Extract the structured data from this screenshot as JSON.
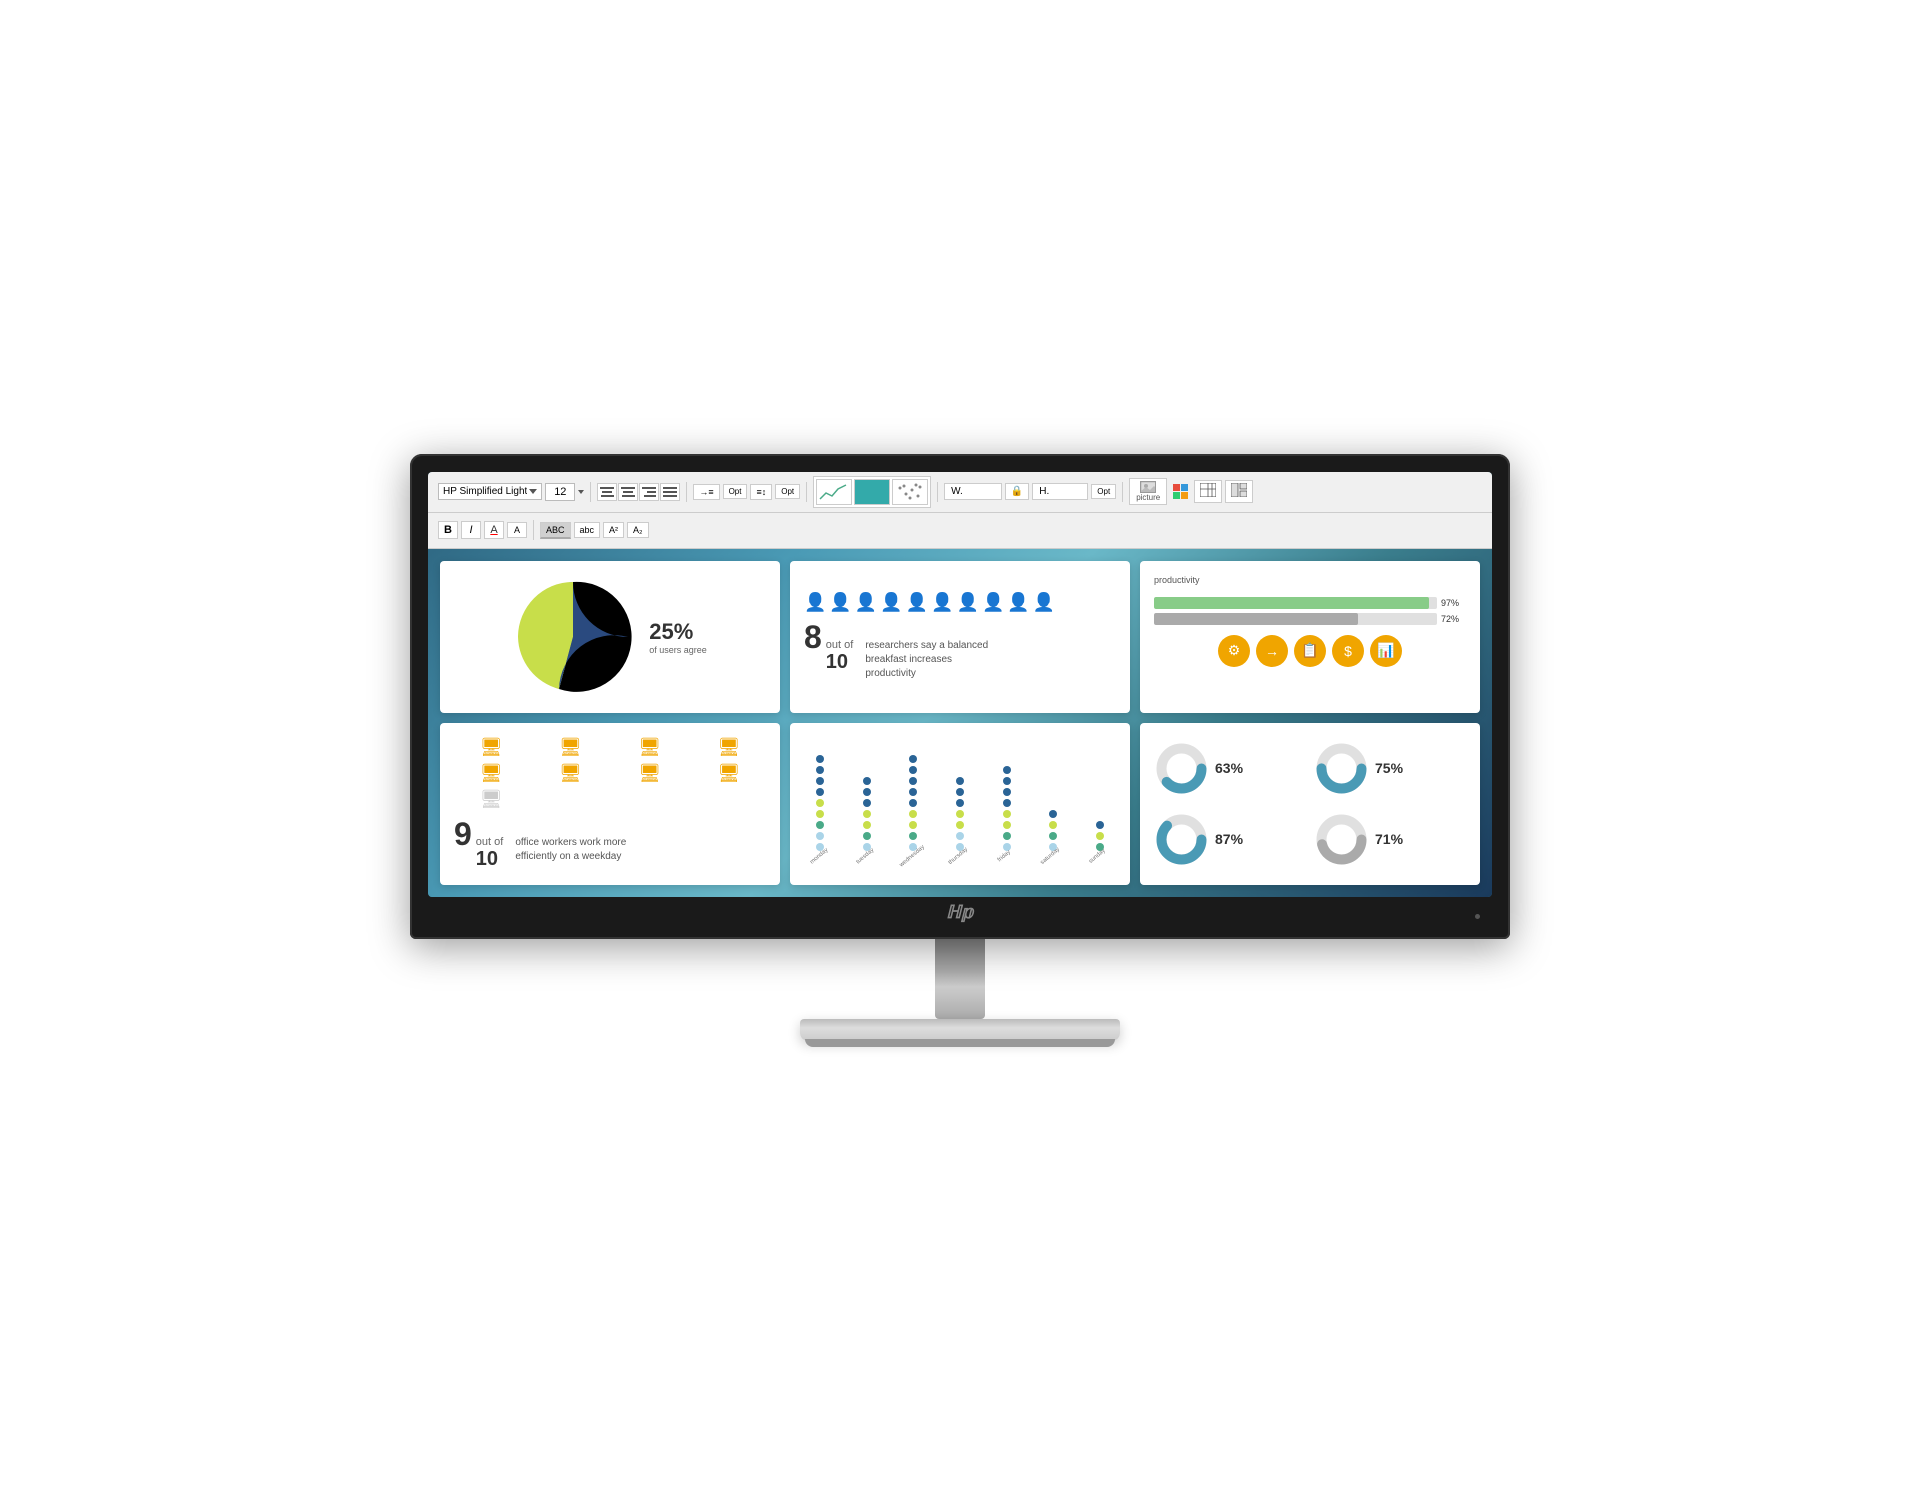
{
  "monitor": {
    "brand": "hp",
    "logo_symbol": "ℍ𝕡"
  },
  "toolbar": {
    "font_family": "HP Simplified Light",
    "font_size": "12",
    "bold": "B",
    "italic": "I",
    "font_a_upper": "A",
    "font_a_lower": "A",
    "abc_upper": "ABC",
    "abc_lower": "abc",
    "superscript": "A²",
    "subscript": "A₂",
    "picture_label": "picture",
    "width_label": "W.",
    "height_label": "H.",
    "opt_label": "Opt"
  },
  "slide": {
    "card_pie": {
      "percent": "25%",
      "sublabel": "of users agree"
    },
    "card_researchers": {
      "big_num": "8",
      "out_of": "out of",
      "of_num": "10",
      "description": "researchers say a balanced breakfast increases productivity",
      "filled_icons": 8,
      "total_icons": 10
    },
    "card_productivity": {
      "title": "productivity",
      "bar1_label": "",
      "bar1_pct": "97%",
      "bar1_value": 97,
      "bar1_color": "#88cc88",
      "bar2_label": "",
      "bar2_pct": "72%",
      "bar2_value": 72,
      "bar2_color": "#aaaaaa"
    },
    "card_computers": {
      "big_num": "9",
      "out_of": "out of",
      "of_num": "10",
      "description": "office workers work more efficiently on a weekday",
      "filled_count": 9,
      "total_count": 10
    },
    "card_dotchart": {
      "days": [
        "monday",
        "tuesday",
        "wednesday",
        "thursday",
        "friday",
        "saturday",
        "sunday"
      ],
      "dot_rows": 9,
      "colors": [
        "#2a6496",
        "#4aaa88",
        "#aad4e8",
        "#c8de6a"
      ]
    },
    "card_donuts": [
      {
        "pct": 63,
        "color": "#4a9ab5",
        "label": "63%"
      },
      {
        "pct": 75,
        "color": "#4a9ab5",
        "label": "75%"
      },
      {
        "pct": 87,
        "color": "#4a9ab5",
        "label": "87%"
      },
      {
        "pct": 71,
        "color": "#aaaaaa",
        "label": "71%"
      }
    ]
  }
}
